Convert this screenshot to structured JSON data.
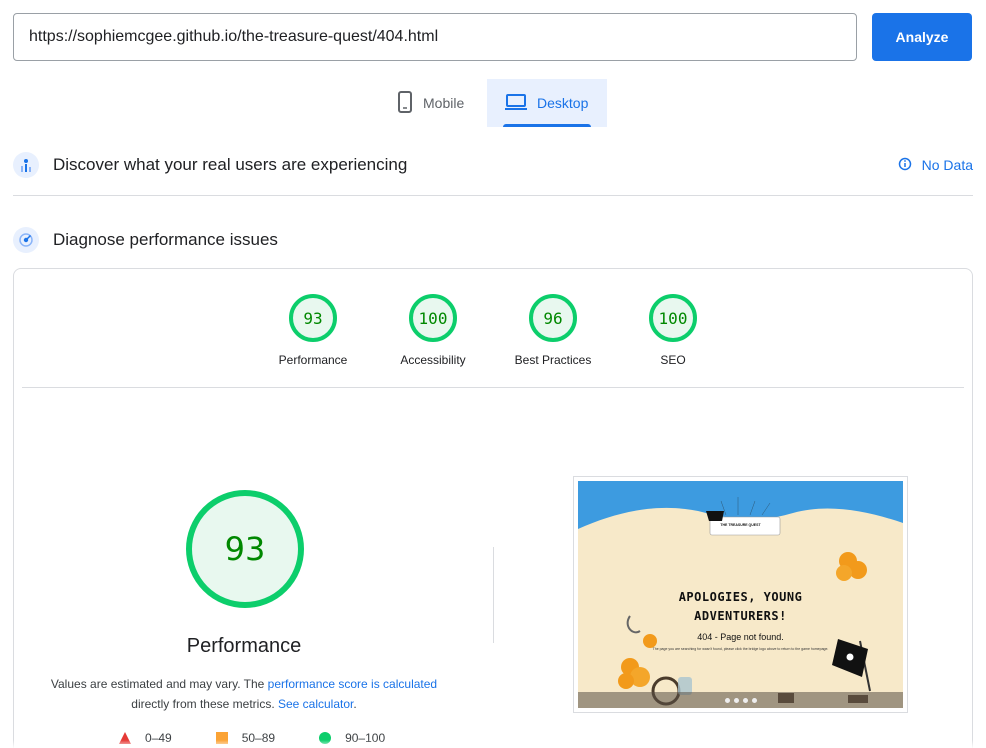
{
  "url_bar": {
    "value": "https://sophiemcgee.github.io/the-treasure-quest/404.html"
  },
  "analyze_label": "Analyze",
  "tabs": [
    {
      "label": "Mobile",
      "icon": "mobile-icon",
      "selected": false
    },
    {
      "label": "Desktop",
      "icon": "desktop-icon",
      "selected": true
    }
  ],
  "real_users": {
    "title": "Discover what your real users are experiencing",
    "status": "No Data"
  },
  "diagnose": {
    "title": "Diagnose performance issues"
  },
  "scores": [
    {
      "label": "Performance",
      "value": "93"
    },
    {
      "label": "Accessibility",
      "value": "100"
    },
    {
      "label": "Best Practices",
      "value": "96"
    },
    {
      "label": "SEO",
      "value": "100"
    }
  ],
  "performance": {
    "score": "93",
    "title": "Performance",
    "note_pre": "Values are estimated and may vary. The ",
    "note_link": "performance score is calculated",
    "note_mid": " directly from these metrics. ",
    "note_link2": "See calculator",
    "note_end": "."
  },
  "legend": [
    {
      "range": "0–49",
      "shape": "triangle",
      "color": "#e53935"
    },
    {
      "range": "50–89",
      "shape": "square",
      "color": "#fba335"
    },
    {
      "range": "90–100",
      "shape": "circle",
      "color": "#0cce6b"
    }
  ],
  "screenshot": {
    "heading_line1": "APOLOGIES, YOUNG",
    "heading_line2": "ADVENTURERS!",
    "subheading": "404 - Page not found.",
    "banner": "THE TREASURE QUEST",
    "body": "The page you are searching for wasn't found, please click the bridge logo above to return to the game homepage."
  },
  "colors": {
    "accent": "#1a73e8",
    "good": "#0cce6b",
    "good_text": "#008800",
    "good_fill": "#e8f8ef"
  }
}
